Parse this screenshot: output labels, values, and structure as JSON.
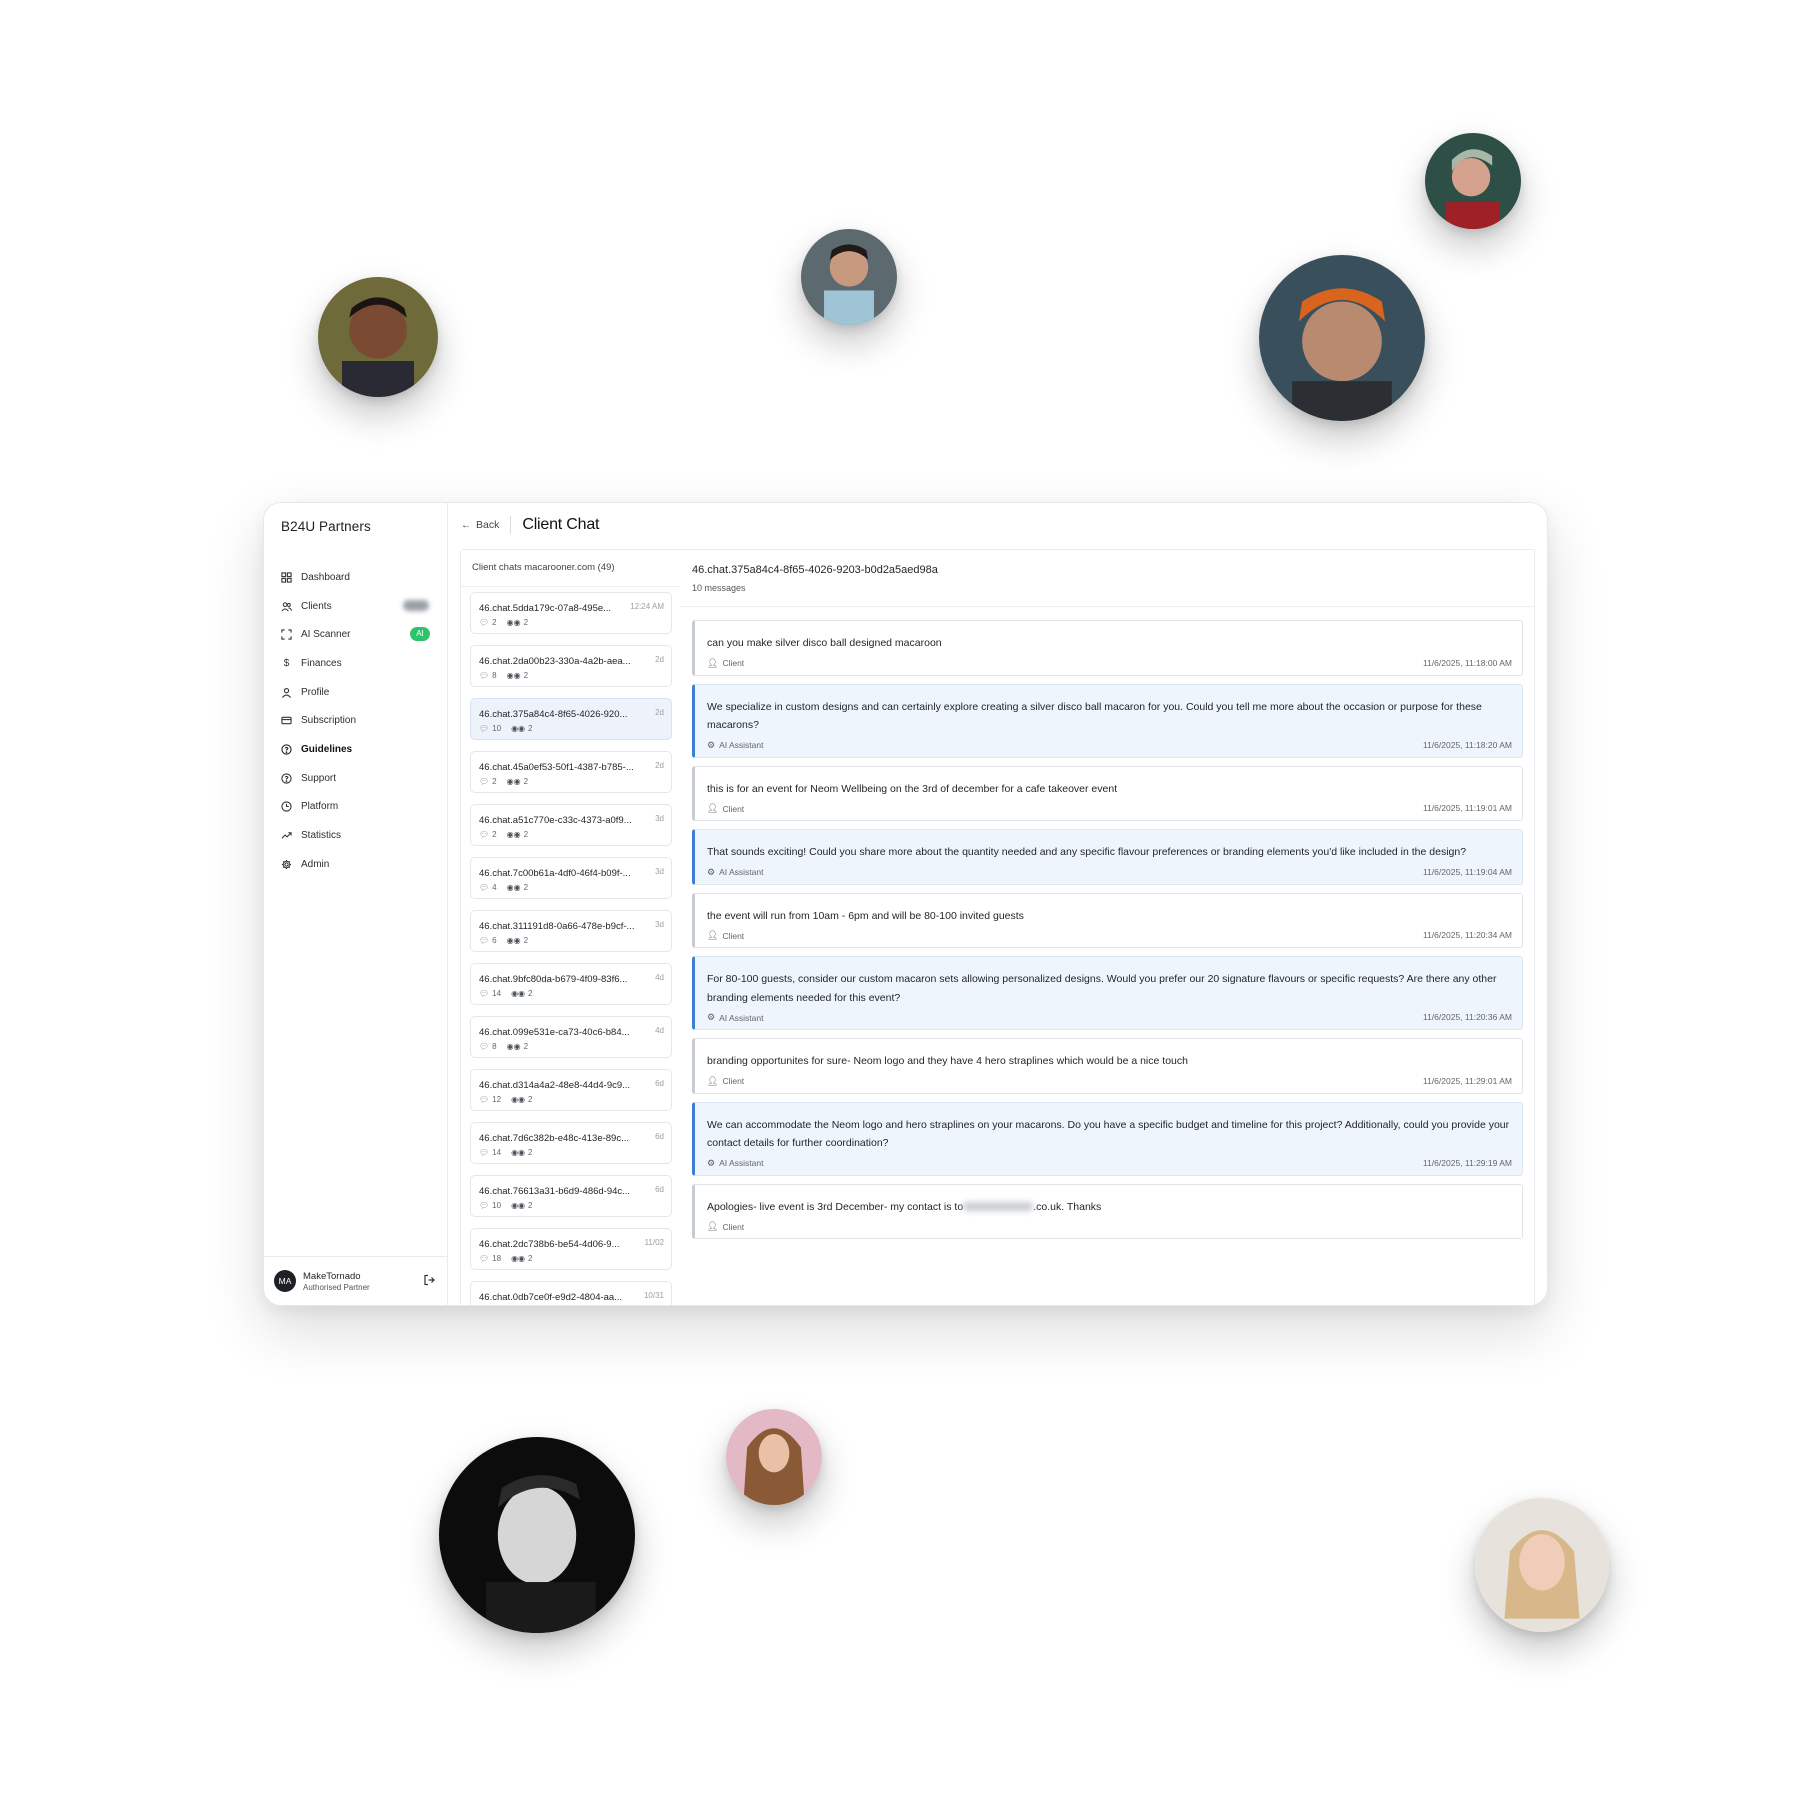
{
  "app": {
    "brand": "B24U Partners",
    "back_label": "Back",
    "page_title": "Client Chat"
  },
  "sidebar": {
    "items": [
      {
        "label": "Dashboard",
        "icon": "grid-icon"
      },
      {
        "label": "Clients",
        "icon": "users-icon",
        "badge": "blurred"
      },
      {
        "label": "AI Scanner",
        "icon": "scan-icon",
        "badge": "AI"
      },
      {
        "label": "Finances",
        "icon": "dollar-icon"
      },
      {
        "label": "Profile",
        "icon": "user-icon"
      },
      {
        "label": "Subscription",
        "icon": "card-icon"
      },
      {
        "label": "Guidelines",
        "icon": "help-circle-icon",
        "active": true
      },
      {
        "label": "Support",
        "icon": "help-circle-icon"
      },
      {
        "label": "Platform",
        "icon": "clock-icon"
      },
      {
        "label": "Statistics",
        "icon": "trend-icon"
      },
      {
        "label": "Admin",
        "icon": "gear-icon"
      }
    ],
    "user": {
      "initials": "MA",
      "name": "MakeTornado",
      "role": "Authorised Partner"
    }
  },
  "chat_list": {
    "header": "Client chats macarooner.com (49)",
    "items": [
      {
        "id": "46.chat.5dda179c-07a8-495e...",
        "time": "12:24 AM",
        "messages": "2",
        "participants": "2"
      },
      {
        "id": "46.chat.2da00b23-330a-4a2b-aea...",
        "time": "2d",
        "messages": "8",
        "participants": "2"
      },
      {
        "id": "46.chat.375a84c4-8f65-4026-920...",
        "time": "2d",
        "messages": "10",
        "participants": "2",
        "selected": true
      },
      {
        "id": "46.chat.45a0ef53-50f1-4387-b785-...",
        "time": "2d",
        "messages": "2",
        "participants": "2"
      },
      {
        "id": "46.chat.a51c770e-c33c-4373-a0f9...",
        "time": "3d",
        "messages": "2",
        "participants": "2"
      },
      {
        "id": "46.chat.7c00b61a-4df0-46f4-b09f-...",
        "time": "3d",
        "messages": "4",
        "participants": "2"
      },
      {
        "id": "46.chat.311191d8-0a66-478e-b9cf-...",
        "time": "3d",
        "messages": "6",
        "participants": "2"
      },
      {
        "id": "46.chat.9bfc80da-b679-4f09-83f6...",
        "time": "4d",
        "messages": "14",
        "participants": "2"
      },
      {
        "id": "46.chat.099e531e-ca73-40c6-b84...",
        "time": "4d",
        "messages": "8",
        "participants": "2"
      },
      {
        "id": "46.chat.d314a4a2-48e8-44d4-9c9...",
        "time": "6d",
        "messages": "12",
        "participants": "2"
      },
      {
        "id": "46.chat.7d6c382b-e48c-413e-89c...",
        "time": "6d",
        "messages": "14",
        "participants": "2"
      },
      {
        "id": "46.chat.76613a31-b6d9-486d-94c...",
        "time": "6d",
        "messages": "10",
        "participants": "2"
      },
      {
        "id": "46.chat.2dc738b6-be54-4d06-9...",
        "time": "11/02",
        "messages": "18",
        "participants": "2"
      },
      {
        "id": "46.chat.0db7ce0f-e9d2-4804-aa...",
        "time": "10/31",
        "messages": "",
        "participants": ""
      }
    ]
  },
  "conversation": {
    "title": "46.chat.375a84c4-8f65-4026-9203-b0d2a5aed98a",
    "count": "10 messages",
    "messages": [
      {
        "role": "Client",
        "text": "can you make silver disco ball designed macaroon",
        "time": "11/6/2025, 11:18:00 AM"
      },
      {
        "role": "AI Assistant",
        "text": "We specialize in custom designs and can certainly explore creating a silver disco ball macaron for you. Could you tell me more about the occasion or purpose for these macarons?",
        "time": "11/6/2025, 11:18:20 AM"
      },
      {
        "role": "Client",
        "text": "this is for an event for Neom Wellbeing on the 3rd of december for a cafe takeover event",
        "time": "11/6/2025, 11:19:01 AM"
      },
      {
        "role": "AI Assistant",
        "text": "That sounds exciting! Could you share more about the quantity needed and any specific flavour preferences or branding elements you'd like included in the design?",
        "time": "11/6/2025, 11:19:04 AM"
      },
      {
        "role": "Client",
        "text": "the event will run from 10am - 6pm and will be 80-100 invited guests",
        "time": "11/6/2025, 11:20:34 AM"
      },
      {
        "role": "AI Assistant",
        "text": "For 80-100 guests, consider our custom macaron sets allowing personalized designs. Would you prefer our 20 signature flavours or specific requests? Are there any other branding elements needed for this event?",
        "time": "11/6/2025, 11:20:36 AM"
      },
      {
        "role": "Client",
        "text": "branding opportunites for sure- Neom logo and they have 4 hero straplines which would be a nice touch",
        "time": "11/6/2025, 11:29:01 AM"
      },
      {
        "role": "AI Assistant",
        "text": "We can accommodate the Neom logo and hero straplines on your macarons. Do you have a specific budget and timeline for this project? Additionally, could you provide your contact details for further coordination?",
        "time": "11/6/2025, 11:29:19 AM"
      },
      {
        "role": "Client",
        "text_before": "Apologies- live event is 3rd December- my contact is to",
        "text_after": ".co.uk. Thanks",
        "time": ""
      }
    ]
  }
}
